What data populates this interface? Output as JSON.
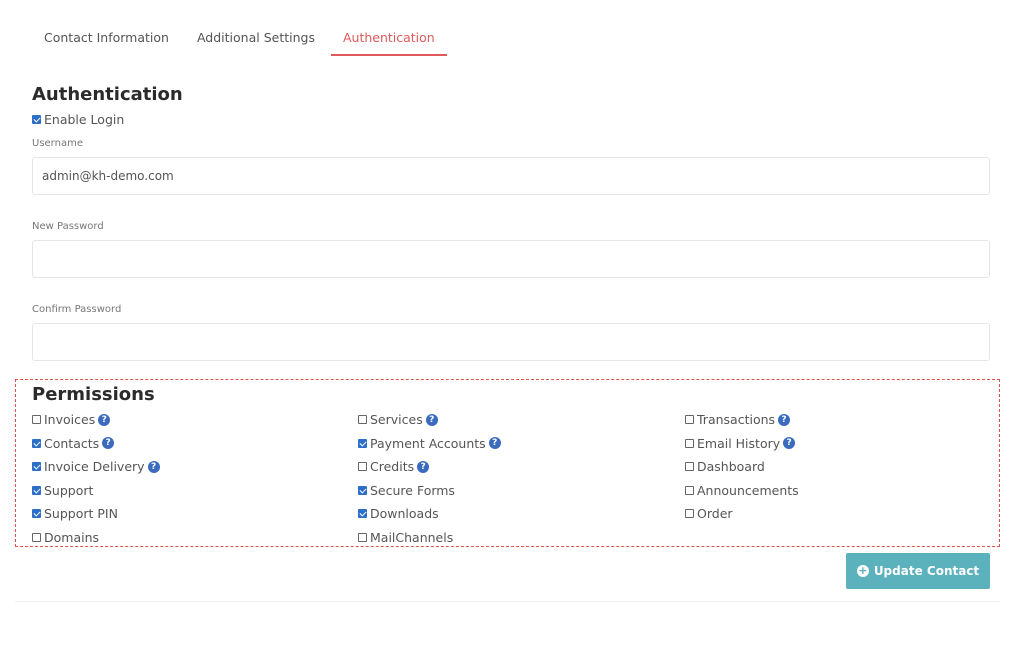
{
  "tabs": [
    {
      "label": "Contact Information",
      "active": false
    },
    {
      "label": "Additional Settings",
      "active": false
    },
    {
      "label": "Authentication",
      "active": true
    }
  ],
  "auth": {
    "title": "Authentication",
    "enable_login": {
      "label": "Enable Login",
      "checked": true
    },
    "username": {
      "label": "Username",
      "value": "admin@kh-demo.com"
    },
    "new_password": {
      "label": "New Password",
      "value": ""
    },
    "confirm_password": {
      "label": "Confirm Password",
      "value": ""
    }
  },
  "permissions": {
    "title": "Permissions",
    "items": [
      {
        "label": "Invoices",
        "checked": false,
        "help": true,
        "help_icon": "question-circle-icon"
      },
      {
        "label": "Services",
        "checked": false,
        "help": true,
        "help_icon": "question-circle-icon"
      },
      {
        "label": "Transactions",
        "checked": false,
        "help": true,
        "help_icon": "question-circle-icon"
      },
      {
        "label": "Contacts",
        "checked": true,
        "help": true,
        "help_icon": "question-circle-icon"
      },
      {
        "label": "Payment Accounts",
        "checked": true,
        "help": true,
        "help_icon": "question-circle-icon"
      },
      {
        "label": "Email History",
        "checked": false,
        "help": true,
        "help_icon": "question-circle-icon"
      },
      {
        "label": "Invoice Delivery",
        "checked": true,
        "help": true,
        "help_icon": "question-circle-icon"
      },
      {
        "label": "Credits",
        "checked": false,
        "help": true,
        "help_icon": "question-circle-icon"
      },
      {
        "label": "Dashboard",
        "checked": false,
        "help": false
      },
      {
        "label": "Support",
        "checked": true,
        "help": false
      },
      {
        "label": "Secure Forms",
        "checked": true,
        "help": false
      },
      {
        "label": "Announcements",
        "checked": false,
        "help": false
      },
      {
        "label": "Support PIN",
        "checked": true,
        "help": false
      },
      {
        "label": "Downloads",
        "checked": true,
        "help": false
      },
      {
        "label": "Order",
        "checked": false,
        "help": false
      },
      {
        "label": "Domains",
        "checked": false,
        "help": false
      },
      {
        "label": "MailChannels",
        "checked": false,
        "help": false
      }
    ]
  },
  "update_button": {
    "label": "Update Contact",
    "icon": "plus-circle-icon"
  },
  "colors": {
    "accent_tab": "#e05a5a",
    "checkbox": "#2d6ec9",
    "help_icon": "#3b6bbf",
    "button": "#5bb2bd",
    "dashed_border": "#d9534f"
  }
}
